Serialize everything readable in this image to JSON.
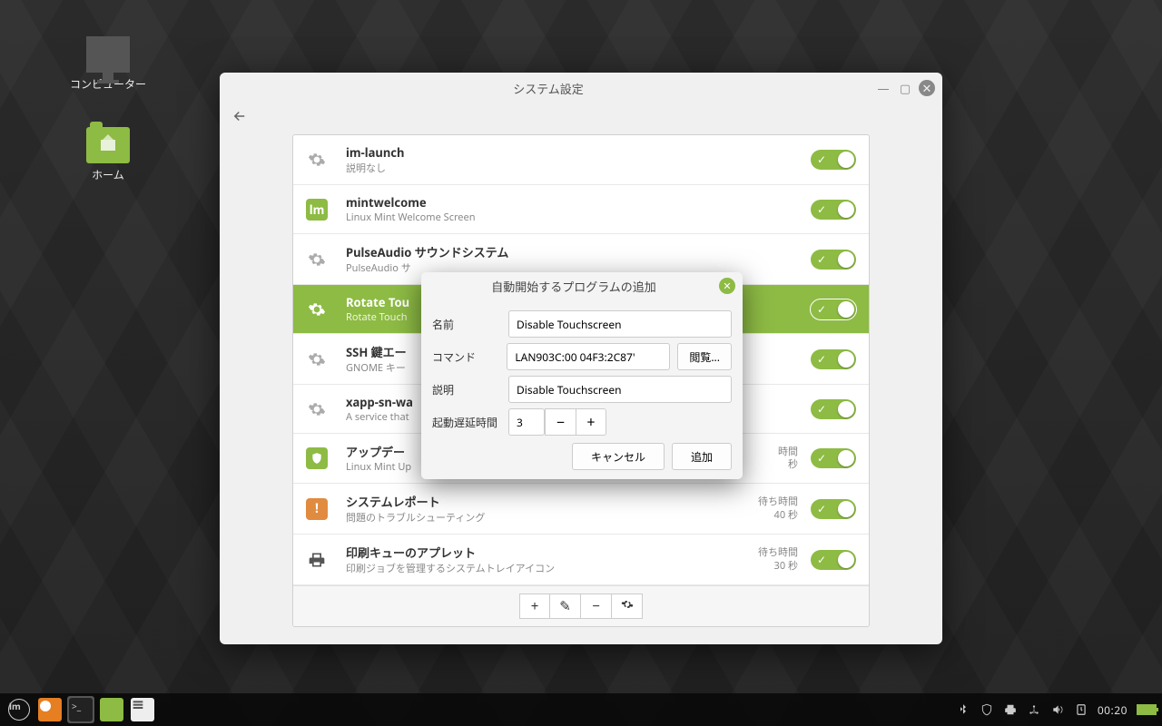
{
  "desktop": {
    "icon_computer": "コンピューター",
    "icon_home": "ホーム"
  },
  "window": {
    "title": "システム設定",
    "startup_items": [
      {
        "title": "im-launch",
        "desc": "説明なし",
        "delay_label": "",
        "delay_value": "",
        "icon": "gear",
        "selected": false
      },
      {
        "title": "mintwelcome",
        "desc": "Linux Mint Welcome Screen",
        "delay_label": "",
        "delay_value": "",
        "icon": "mint",
        "selected": false
      },
      {
        "title": "PulseAudio サウンドシステム",
        "desc": "PulseAudio サ",
        "delay_label": "",
        "delay_value": "",
        "icon": "gear",
        "selected": false
      },
      {
        "title": "Rotate Tou",
        "desc": "Rotate Touch",
        "delay_label": "",
        "delay_value": "",
        "icon": "gear",
        "selected": true
      },
      {
        "title": "SSH 鍵エー",
        "desc": "GNOME キー",
        "delay_label": "",
        "delay_value": "",
        "icon": "gear",
        "selected": false
      },
      {
        "title": "xapp-sn-wa",
        "desc": "A service that",
        "delay_label": "",
        "delay_value": "",
        "icon": "gear",
        "selected": false
      },
      {
        "title": "アップデー",
        "desc": "Linux Mint Up",
        "delay_label": "時間",
        "delay_value": "秒",
        "icon": "shield",
        "selected": false
      },
      {
        "title": "システムレポート",
        "desc": "問題のトラブルシューティング",
        "delay_label": "待ち時間",
        "delay_value": "40 秒",
        "icon": "warn",
        "selected": false
      },
      {
        "title": "印刷キューのアプレット",
        "desc": "印刷ジョブを管理するシステムトレイアイコン",
        "delay_label": "待ち時間",
        "delay_value": "30 秒",
        "icon": "printer",
        "selected": false
      }
    ],
    "buttons": {
      "add": "+",
      "edit": "✎",
      "remove": "−",
      "run": "⚙"
    }
  },
  "modal": {
    "title": "自動開始するプログラムの追加",
    "label_name": "名前",
    "label_command": "コマンド",
    "label_desc": "説明",
    "label_delay": "起動遅延時間",
    "value_name": "Disable Touchscreen",
    "value_command": "LAN903C:00 04F3:2C87'",
    "value_desc": "Disable Touchscreen",
    "value_delay": "3",
    "browse": "閲覧...",
    "cancel": "キャンセル",
    "ok": "追加"
  },
  "panel": {
    "clock": "00:20"
  }
}
